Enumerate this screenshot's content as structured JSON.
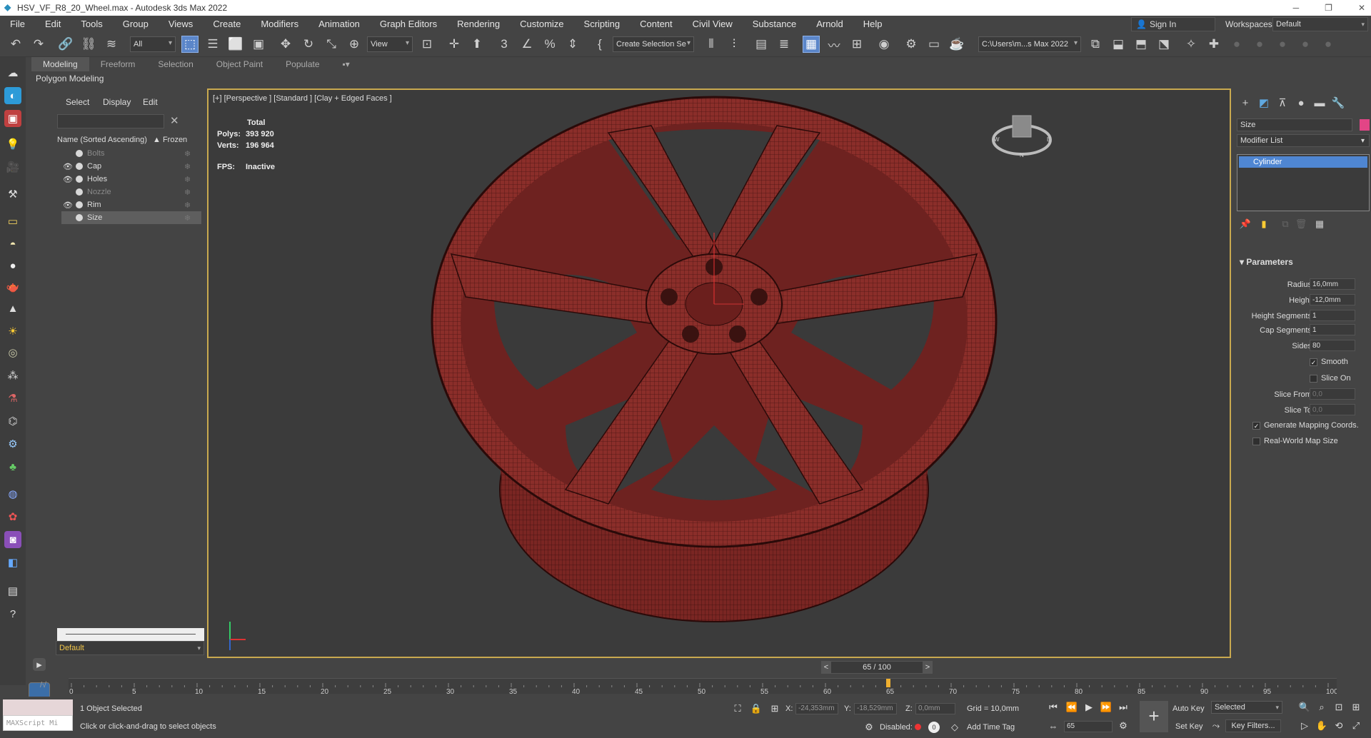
{
  "window": {
    "title": "HSV_VF_R8_20_Wheel.max - Autodesk 3ds Max 2022"
  },
  "menu": [
    "File",
    "Edit",
    "Tools",
    "Group",
    "Views",
    "Create",
    "Modifiers",
    "Animation",
    "Graph Editors",
    "Rendering",
    "Customize",
    "Scripting",
    "Content",
    "Civil View",
    "Substance",
    "Arnold",
    "Help"
  ],
  "account": {
    "sign_in": "Sign In",
    "workspaces_label": "Workspaces:",
    "workspace": "Default"
  },
  "toolbar": {
    "filter": "All",
    "view": "View",
    "selection_set": "Create Selection Se",
    "project_path": "C:\\Users\\m...s Max 2022"
  },
  "ribbon": {
    "tabs": [
      "Modeling",
      "Freeform",
      "Selection",
      "Object Paint",
      "Populate"
    ],
    "active": "Modeling",
    "panel": "Polygon Modeling"
  },
  "explorer": {
    "tabs": [
      "Select",
      "Display",
      "Edit"
    ],
    "col_name": "Name (Sorted Ascending)",
    "col_frozen": "▲ Frozen",
    "items": [
      {
        "name": "Bolts",
        "visible": false
      },
      {
        "name": "Cap",
        "visible": true
      },
      {
        "name": "Holes",
        "visible": true
      },
      {
        "name": "Nozzle",
        "visible": false
      },
      {
        "name": "Rim",
        "visible": true
      },
      {
        "name": "Size",
        "visible": false,
        "selected": true
      }
    ],
    "layer": "Default"
  },
  "viewport": {
    "label": "[+] [Perspective ] [Standard ] [Clay + Edged Faces ]",
    "stats": {
      "header": "Total",
      "polys_label": "Polys:",
      "polys": "393 920",
      "verts_label": "Verts:",
      "verts": "196 964",
      "fps_label": "FPS:",
      "fps": "Inactive"
    }
  },
  "command_panel": {
    "object_name": "Size",
    "modifier_list": "Modifier List",
    "stack_item": "Cylinder",
    "params_title": "Parameters",
    "params": [
      {
        "label": "Radius:",
        "value": "16,0mm"
      },
      {
        "label": "Height:",
        "value": "-12,0mm"
      },
      {
        "label": "Height Segments:",
        "value": "1"
      },
      {
        "label": "Cap Segments:",
        "value": "1"
      },
      {
        "label": "Sides:",
        "value": "80"
      }
    ],
    "smooth": "Smooth",
    "slice_on": "Slice On",
    "slice_from_label": "Slice From:",
    "slice_from": "0,0",
    "slice_to_label": "Slice To:",
    "slice_to": "0,0",
    "gen_mapping": "Generate Mapping Coords.",
    "real_world": "Real-World Map Size"
  },
  "timeline": {
    "frame_display": "65 / 100",
    "ticks": [
      "0",
      "5",
      "10",
      "15",
      "20",
      "25",
      "30",
      "35",
      "40",
      "45",
      "50",
      "55",
      "60",
      "65",
      "70",
      "75",
      "80",
      "85",
      "90",
      "95",
      "100"
    ],
    "current_frame": 65,
    "total_frames": 100
  },
  "status": {
    "maxscript": "MAXScript Mi",
    "selected": "1 Object Selected",
    "prompt": "Click or click-and-drag to select objects",
    "x_label": "X:",
    "x": "-24,353mm",
    "y_label": "Y:",
    "y": "-18,529mm",
    "z_label": "Z:",
    "z": "0,0mm",
    "grid": "Grid = 10,0mm",
    "disabled": "Disabled:",
    "add_time_tag": "Add Time Tag",
    "auto_key": "Auto Key",
    "set_key": "Set Key",
    "key_mode": "Selected",
    "key_filters": "Key Filters...",
    "frame": "65"
  }
}
